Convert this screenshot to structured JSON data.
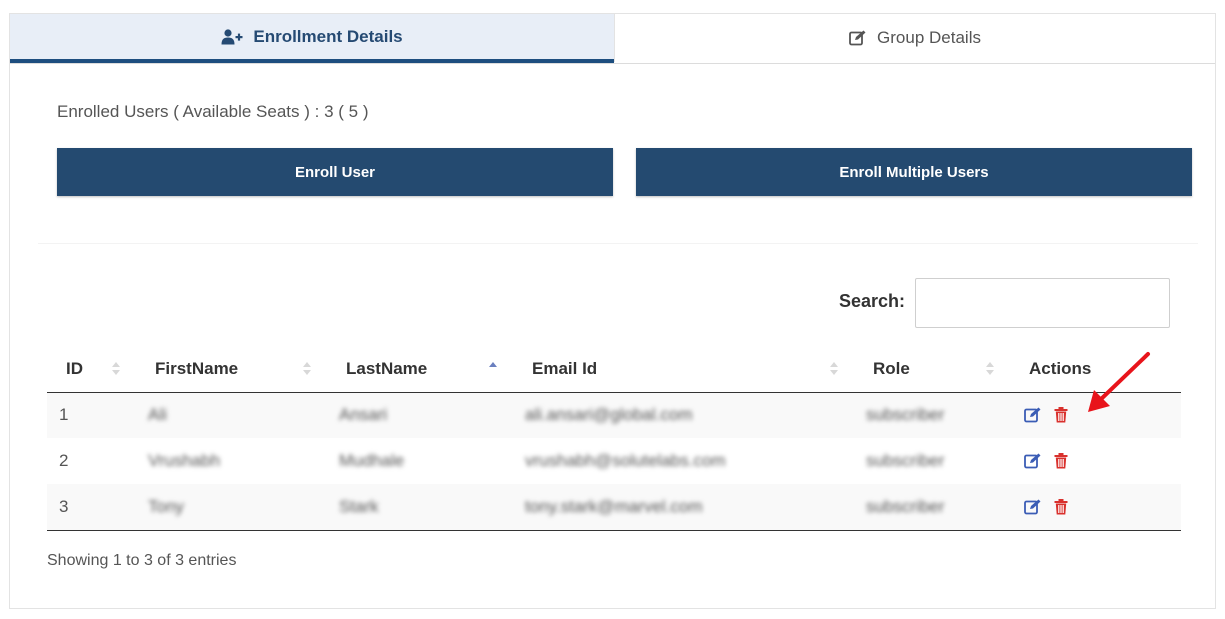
{
  "tabs": [
    {
      "label": "Enrollment Details",
      "icon": "user-plus-icon",
      "active": true
    },
    {
      "label": "Group Details",
      "icon": "edit-icon",
      "active": false
    }
  ],
  "enrollment": {
    "summary_prefix": "Enrolled Users ( Available Seats ) : ",
    "enrolled_count": "3",
    "available_seats": "( 5 )"
  },
  "buttons": {
    "enroll_user": "Enroll User",
    "enroll_multiple": "Enroll Multiple Users"
  },
  "search": {
    "label": "Search:",
    "value": "",
    "placeholder": ""
  },
  "table": {
    "columns": [
      "ID",
      "FirstName",
      "LastName",
      "Email Id",
      "Role",
      "Actions"
    ],
    "sorted_column": "LastName",
    "sort_direction": "ascending",
    "rows": [
      {
        "id": "1",
        "first": "Ali",
        "last": "Ansari",
        "email": "ali.ansari@global.com",
        "role": "subscriber"
      },
      {
        "id": "2",
        "first": "Vrushabh",
        "last": "Mudhale",
        "email": "vrushabh@solutelabs.com",
        "role": "subscriber"
      },
      {
        "id": "3",
        "first": "Tony",
        "last": "Stark",
        "email": "tony.stark@marvel.com",
        "role": "subscriber"
      }
    ]
  },
  "footer": {
    "showing": "Showing 1 to 3 of 3 entries"
  },
  "colors": {
    "primary_button": "#244a70",
    "active_tab_bg": "#e8eef7",
    "edit_icon": "#3b5db5",
    "delete_icon": "#d9312d",
    "annotation_arrow": "#e8141b"
  }
}
